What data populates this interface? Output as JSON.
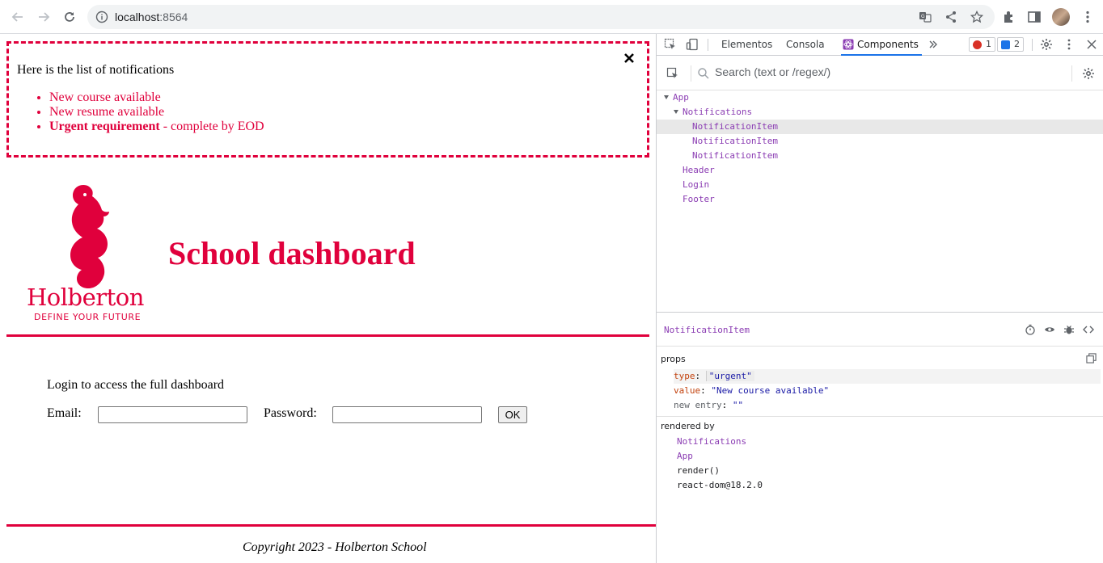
{
  "browser": {
    "url_host": "localhost",
    "url_port": ":8564"
  },
  "notifications": {
    "title": "Here is the list of notifications",
    "items": [
      {
        "text": "New course available",
        "type": "default"
      },
      {
        "text": "New resume available",
        "type": "default"
      },
      {
        "bold": "Urgent requirement",
        "text": " - complete by EOD",
        "type": "urgent"
      }
    ]
  },
  "header": {
    "logo_text": "Holberton",
    "logo_tagline": "DEFINE YOUR FUTURE",
    "title": "School dashboard"
  },
  "login": {
    "heading": "Login to access the full dashboard",
    "email_label": "Email:",
    "password_label": "Password:",
    "email_value": "",
    "password_value": "",
    "submit_label": "OK"
  },
  "footer": {
    "copyright": "Copyright 2023 - Holberton School"
  },
  "devtools": {
    "tabs": [
      "Elementos",
      "Consola",
      "Components"
    ],
    "active_tab": "Components",
    "error_count": "1",
    "message_count": "2",
    "search_placeholder": "Search (text or /regex/)",
    "tree": [
      {
        "label": "App",
        "expanded": true
      },
      {
        "label": "Notifications",
        "expanded": true
      },
      {
        "label": "NotificationItem",
        "selected": true
      },
      {
        "label": "NotificationItem"
      },
      {
        "label": "NotificationItem"
      },
      {
        "label": "Header"
      },
      {
        "label": "Login"
      },
      {
        "label": "Footer"
      }
    ],
    "selected_component": "NotificationItem",
    "props_label": "props",
    "props": [
      {
        "key": "type",
        "value": "\"urgent\""
      },
      {
        "key": "value",
        "value": "\"New course available\""
      },
      {
        "key": "new entry",
        "value": "\"\""
      }
    ],
    "rendered_by_label": "rendered by",
    "rendered_by": [
      {
        "label": "Notifications",
        "kind": "component"
      },
      {
        "label": "App",
        "kind": "component"
      },
      {
        "label": "render()",
        "kind": "plain"
      },
      {
        "label": "react-dom@18.2.0",
        "kind": "plain"
      }
    ]
  },
  "colors": {
    "brand": "#e0003c",
    "component": "#8b3db3",
    "accent_blue": "#1a73e8"
  }
}
